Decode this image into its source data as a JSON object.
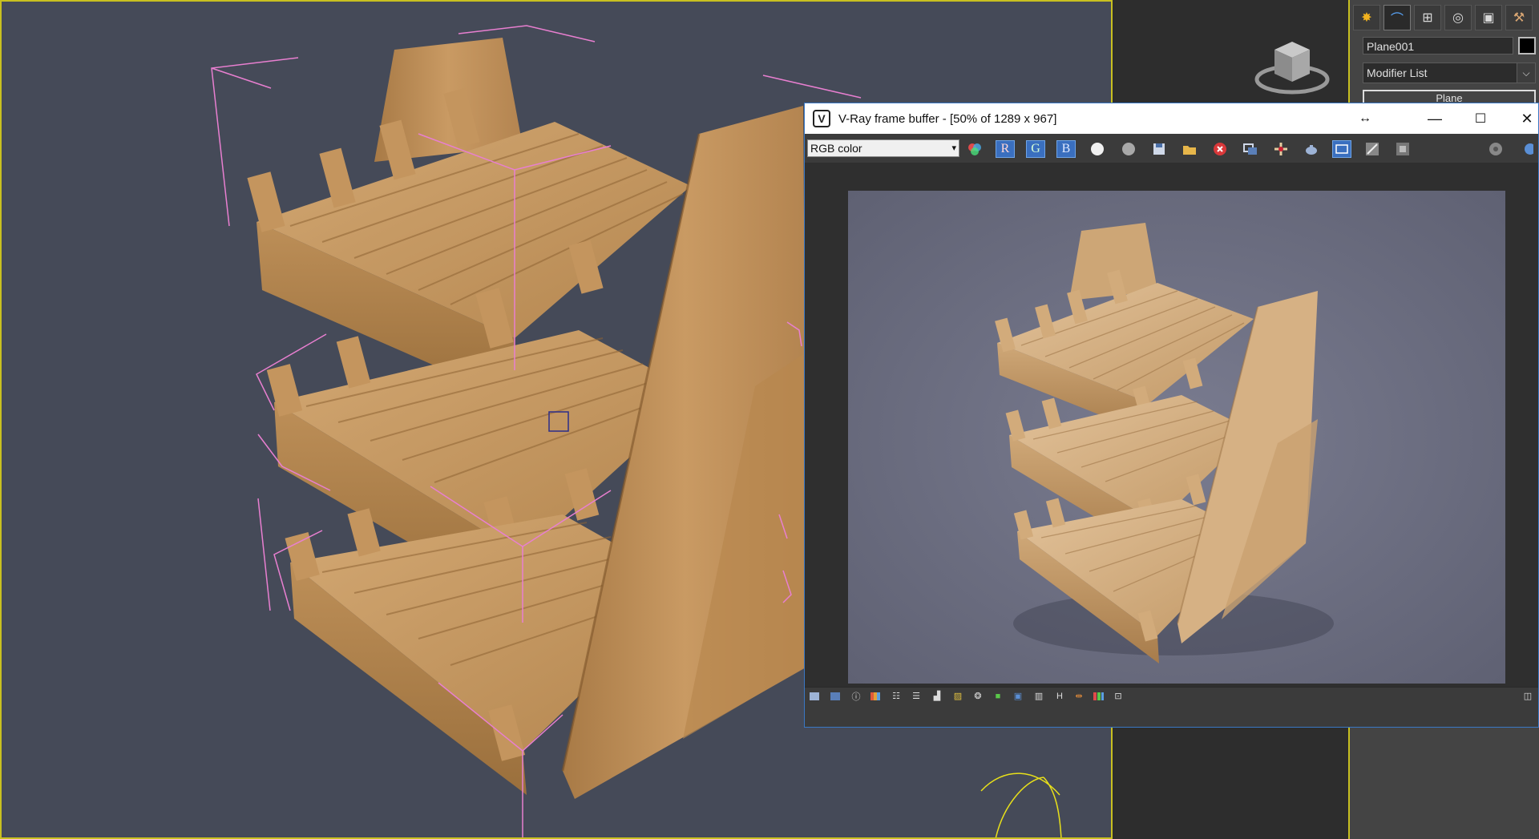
{
  "command_panel": {
    "object_name": "Plane001",
    "modifier_list": "Modifier List",
    "stack_item": "Plane",
    "tabs": [
      {
        "icon": "sun-icon",
        "name": "create"
      },
      {
        "icon": "curve-icon",
        "name": "modify"
      },
      {
        "icon": "hierarchy-icon",
        "name": "hierarchy"
      },
      {
        "icon": "motion-icon",
        "name": "motion"
      },
      {
        "icon": "display-icon",
        "name": "display"
      },
      {
        "icon": "hammer-icon",
        "name": "utilities"
      }
    ]
  },
  "vfb": {
    "title": "V-Ray frame buffer - [50% of 1289 x 967]",
    "channel": "RGB color",
    "red_label": "R",
    "green_label": "G",
    "blue_label": "B",
    "bottom_h_label": "H"
  },
  "colors": {
    "viewport_bg": "#454a58",
    "viewport_border": "#c8c020",
    "selection_bracket": "#e87fd0",
    "wood": "#c99a63",
    "render_bg": "#6c6e80",
    "vfb_border": "#3a78c5"
  }
}
